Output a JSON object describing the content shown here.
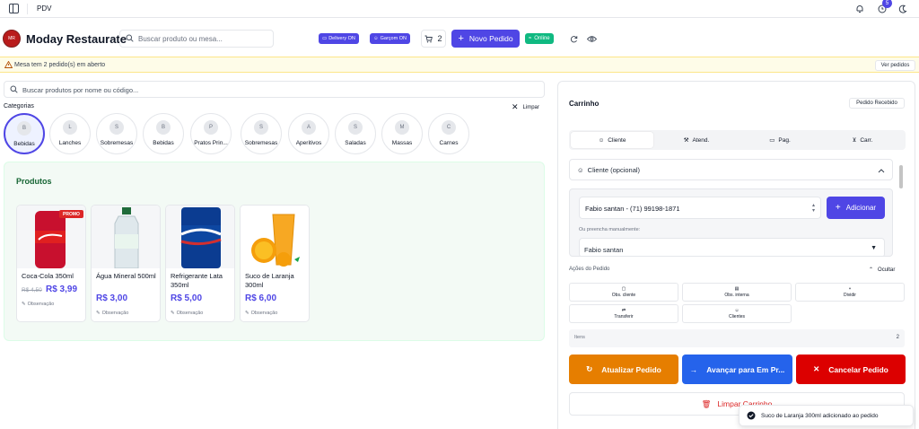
{
  "topbar": {
    "title": "PDV",
    "notification_count": "5"
  },
  "header": {
    "brand": "Moday Restaurate",
    "logo_text": "MR",
    "search_placeholder": "Buscar produto ou mesa...",
    "delivery_label": "Delivery ON",
    "garcom_label": "Garçom ON",
    "cart_count": "2",
    "new_order_label": "Novo Pedido",
    "online_label": "Online"
  },
  "warning": {
    "text": "Mesa tem 2 pedido(s) em aberto",
    "button": "Ver pedidos"
  },
  "products": {
    "search_placeholder": "Buscar produtos por nome ou código...",
    "categories_title": "Categorias",
    "clear_label": "Limpar",
    "categories": [
      {
        "initial": "B",
        "label": "Bebidas",
        "selected": true
      },
      {
        "initial": "L",
        "label": "Lanches"
      },
      {
        "initial": "S",
        "label": "Sobremesas"
      },
      {
        "initial": "B",
        "label": "Bebidas"
      },
      {
        "initial": "P",
        "label": "Pratos Prin..."
      },
      {
        "initial": "S",
        "label": "Sobremesas"
      },
      {
        "initial": "A",
        "label": "Aperitivos"
      },
      {
        "initial": "S",
        "label": "Saladas"
      },
      {
        "initial": "M",
        "label": "Massas"
      },
      {
        "initial": "C",
        "label": "Carnes"
      }
    ],
    "panel_title": "Produtos",
    "items": [
      {
        "name": "Coca-Cola 350ml",
        "old_price": "R$ 4,50",
        "price": "R$ 3,99",
        "promo": "PROMO",
        "obs": "Observação"
      },
      {
        "name": "Água Mineral 500ml",
        "price": "R$ 3,00",
        "obs": "Observação"
      },
      {
        "name": "Refrigerante Lata 350ml",
        "price": "R$ 5,00",
        "obs": "Observação"
      },
      {
        "name": "Suco de Laranja 300ml",
        "price": "R$ 6,00",
        "obs": "Observação"
      }
    ]
  },
  "cart": {
    "title": "Carrinho",
    "status_button": "Pedido Recebido",
    "tabs": [
      "Cliente",
      "Atend.",
      "Pag.",
      "Carr."
    ],
    "accordion_label": "Cliente (opcional)",
    "selected_client": "Fabio santan - (71) 99198-1871",
    "add_label": "Adicionar",
    "manual_hint": "Ou preencha manualmente:",
    "manual_value": "Fabio santan",
    "actions_title": "Ações do Pedido",
    "hide_label": "Ocultar",
    "actions": [
      "Obs. cliente",
      "Obs. interna",
      "Dividir",
      "Transferir",
      "Clientes"
    ],
    "items_label": "Itens",
    "items_count": "2",
    "update_label": "Atualizar Pedido",
    "advance_label": "Avançar para Em Pr...",
    "cancel_label": "Cancelar Pedido",
    "clear_label": "Limpar Carrinho"
  },
  "toast": {
    "text": "Suco de Laranja 300ml adicionado ao pedido"
  },
  "colors": {
    "primary": "#4f46e5",
    "success": "#10b981",
    "orange": "#e67e00",
    "blue": "#2563eb",
    "red": "#dc0000"
  }
}
